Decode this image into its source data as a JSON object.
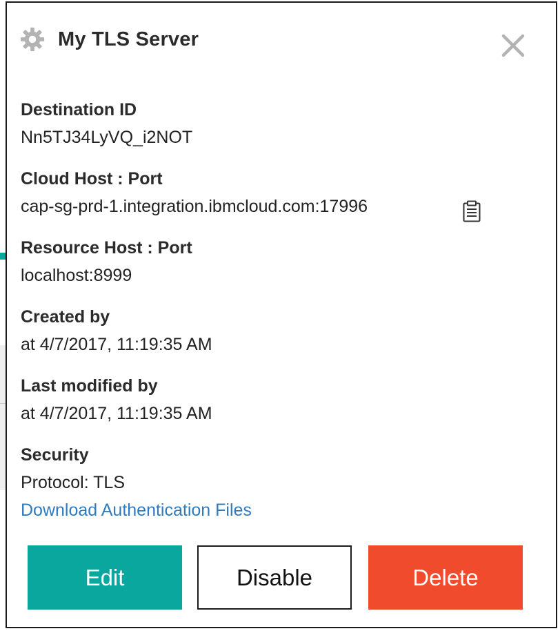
{
  "dialog": {
    "title": "My TLS Server",
    "icons": {
      "header": "gear-icon",
      "close": "close-icon",
      "copy": "clipboard-icon"
    }
  },
  "fields": {
    "destination_id": {
      "label": "Destination ID",
      "value": "Nn5TJ34LyVQ_i2NOT"
    },
    "cloud_host": {
      "label": "Cloud Host : Port",
      "value": "cap-sg-prd-1.integration.ibmcloud.com:17996"
    },
    "resource_host": {
      "label": "Resource Host : Port",
      "value": "localhost:8999"
    },
    "created_by": {
      "label": "Created by",
      "value": "at 4/7/2017, 11:19:35 AM"
    },
    "last_modified_by": {
      "label": "Last modified by",
      "value": "at 4/7/2017, 11:19:35 AM"
    },
    "security": {
      "label": "Security",
      "protocol": "Protocol: TLS",
      "download_link": "Download Authentication Files"
    }
  },
  "actions": {
    "edit_label": "Edit",
    "disable_label": "Disable",
    "delete_label": "Delete"
  },
  "colors": {
    "accent": "#0aa79f",
    "danger": "#f14b2e",
    "link": "#2f7bbf",
    "icon_gray": "#b3b3b3"
  }
}
